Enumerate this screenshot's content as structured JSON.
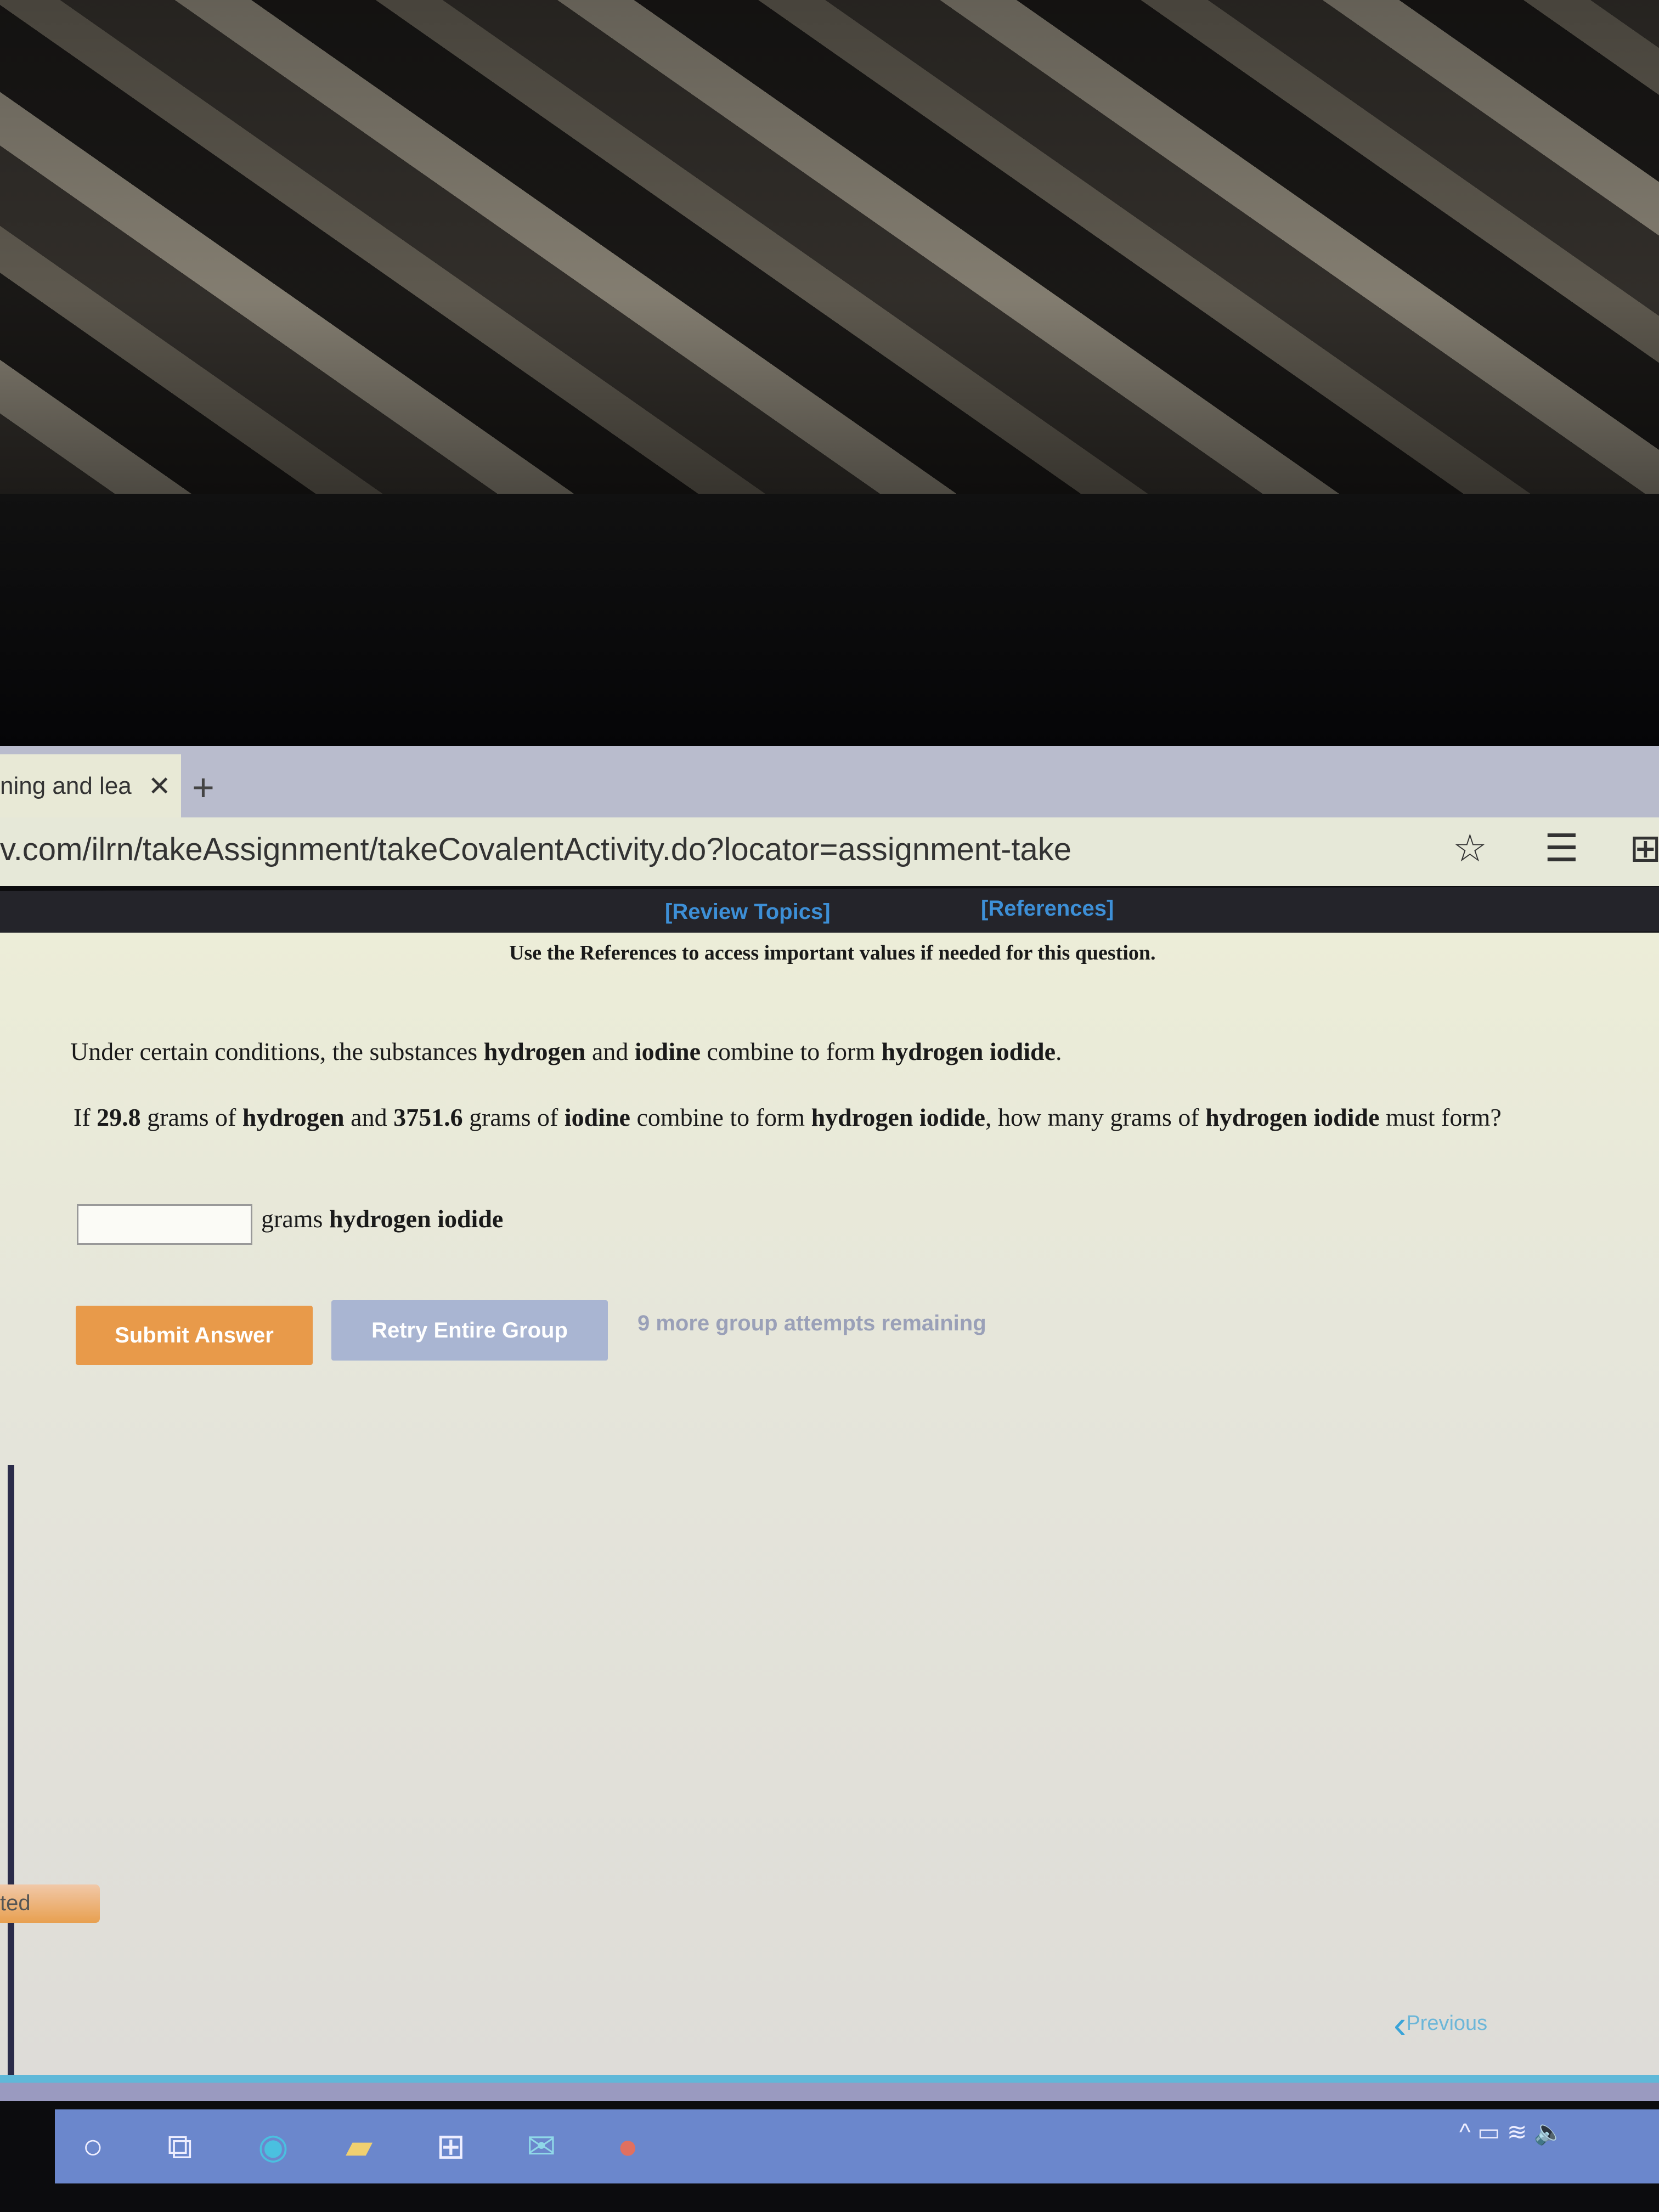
{
  "browser": {
    "tab_title": "ning and lea",
    "tab_close": "✕",
    "new_tab": "+",
    "url": "v.com/ilrn/takeAssignment/takeCovalentActivity.do?locator=assignment-take",
    "icons": [
      "favorites-star-icon",
      "reading-list-icon",
      "collections-icon"
    ]
  },
  "nav": {
    "review_topics": "[Review Topics]",
    "references": "[References]"
  },
  "question": {
    "reference_note": "Use the References to access important values if needed for this question.",
    "intro": {
      "t1": "Under certain conditions, the substances ",
      "b1": "hydrogen",
      "t2": " and ",
      "b2": "iodine",
      "t3": " combine to form ",
      "b3": "hydrogen iodide",
      "t4": "."
    },
    "prompt": {
      "t1": "If ",
      "b1": "29.8",
      "t2": " grams of ",
      "b2": "hydrogen",
      "t3": " and ",
      "b3": "3751.6",
      "t4": " grams of ",
      "b4": "iodine",
      "t5": " combine to form ",
      "b5": "hydrogen iodide",
      "t6": ", how many grams of ",
      "b6": "hydrogen iodide",
      "t7": " must form?"
    },
    "answer_value": "",
    "unit_label": "grams hydrogen iodide",
    "unit_bold": "hydrogen iodide",
    "unit_plain": "grams "
  },
  "actions": {
    "submit": "Submit Answer",
    "retry": "Retry Entire Group",
    "remaining": "9 more group attempts remaining"
  },
  "sidebar_tab": "ted",
  "pager": {
    "previous": "Previous"
  },
  "colors": {
    "submit": "#e89a4a",
    "retry": "#a9b5d2",
    "nav_bar": "#24242a",
    "link": "#3d8fd6",
    "taskbar": "#6b87cc"
  }
}
